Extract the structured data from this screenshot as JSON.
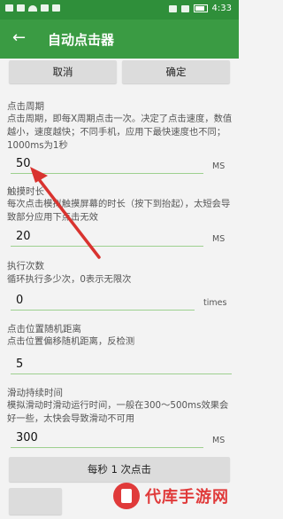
{
  "status": {
    "time": "4:33"
  },
  "appbar": {
    "back_glyph": "←",
    "title": "自动点击器"
  },
  "actions": {
    "cancel": "取消",
    "confirm": "确定"
  },
  "click_period": {
    "title": "点击周期",
    "desc": "点击周期，即每X周期点击一次。决定了点击速度，数值越小，速度越快；不同手机，应用下最快速度也不同；1000ms为1秒",
    "value": "50",
    "unit": "MS"
  },
  "touch_duration": {
    "title": "触摸时长",
    "desc": "每次点击模拟触摸屏幕的时长（按下到抬起），太短会导致部分应用下点击无效",
    "value": "20",
    "unit": "MS"
  },
  "exec_count": {
    "title": "执行次数",
    "desc": "循环执行多少次，0表示无限次",
    "value": "0",
    "unit": "times"
  },
  "random_distance": {
    "title": "点击位置随机距离",
    "desc": "点击位置偏移随机距离，反检测",
    "value": "5"
  },
  "swipe_duration": {
    "title": "滑动持续时间",
    "desc": "模拟滑动时滑动运行时间，一般在300～500ms效果会好一些，太快会导致滑动不可用",
    "value": "300",
    "unit": "MS"
  },
  "rate_button": "每秒 1 次点击",
  "watermark": {
    "text": "代库手游网"
  }
}
